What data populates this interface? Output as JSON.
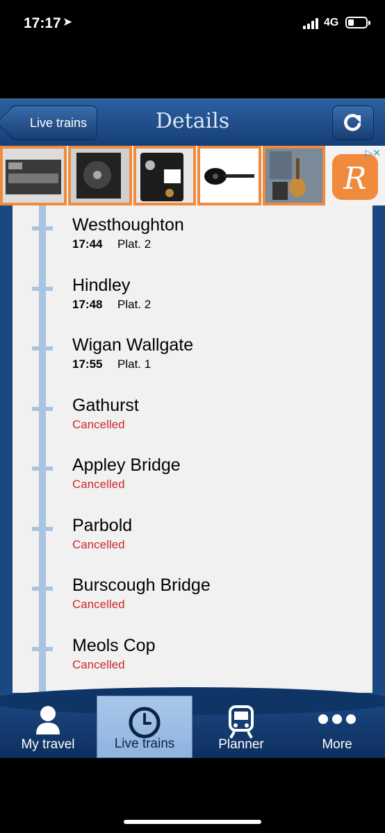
{
  "status_bar": {
    "time": "17:17",
    "network": "4G"
  },
  "nav": {
    "back_label": "Live trains",
    "title": "Details"
  },
  "stops": [
    {
      "name": "Westhoughton",
      "time": "17:44",
      "platform": "Plat. 2",
      "status": ""
    },
    {
      "name": "Hindley",
      "time": "17:48",
      "platform": "Plat. 2",
      "status": ""
    },
    {
      "name": "Wigan Wallgate",
      "time": "17:55",
      "platform": "Plat. 1",
      "status": ""
    },
    {
      "name": "Gathurst",
      "time": "",
      "platform": "",
      "status": "Cancelled"
    },
    {
      "name": "Appley Bridge",
      "time": "",
      "platform": "",
      "status": "Cancelled"
    },
    {
      "name": "Parbold",
      "time": "",
      "platform": "",
      "status": "Cancelled"
    },
    {
      "name": "Burscough Bridge",
      "time": "",
      "platform": "",
      "status": "Cancelled"
    },
    {
      "name": "Meols Cop",
      "time": "",
      "platform": "",
      "status": "Cancelled"
    }
  ],
  "tabs": [
    {
      "label": "My travel",
      "icon": "person-icon"
    },
    {
      "label": "Live trains",
      "icon": "clock-icon",
      "active": true
    },
    {
      "label": "Planner",
      "icon": "train-icon"
    },
    {
      "label": "More",
      "icon": "more-dots-icon"
    }
  ],
  "colors": {
    "accent": "#1a4880",
    "cancelled": "#d0282c",
    "track": "#a9c3e2"
  }
}
